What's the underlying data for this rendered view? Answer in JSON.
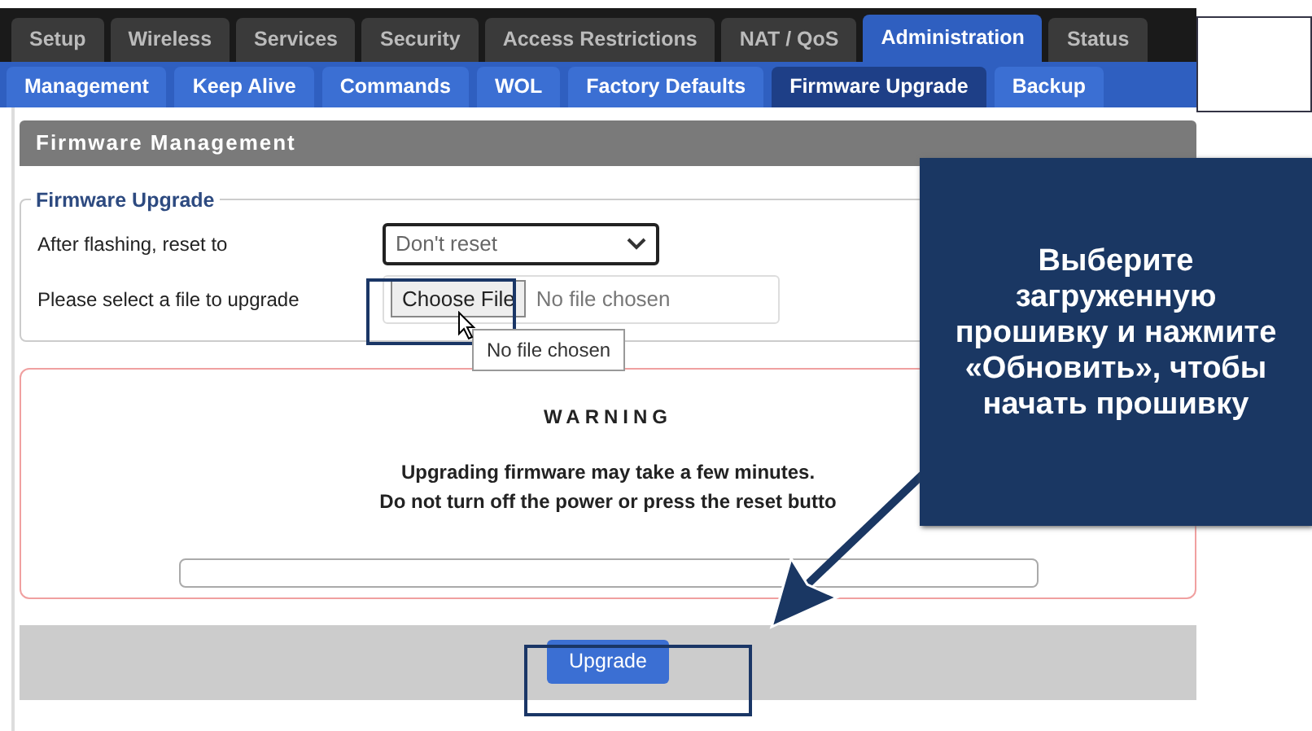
{
  "top_tabs": [
    {
      "label": "Setup",
      "selected": false
    },
    {
      "label": "Wireless",
      "selected": false
    },
    {
      "label": "Services",
      "selected": false
    },
    {
      "label": "Security",
      "selected": false
    },
    {
      "label": "Access Restrictions",
      "selected": false
    },
    {
      "label": "NAT / QoS",
      "selected": false
    },
    {
      "label": "Administration",
      "selected": true
    },
    {
      "label": "Status",
      "selected": false
    }
  ],
  "sub_tabs": [
    {
      "label": "Management",
      "selected": false
    },
    {
      "label": "Keep Alive",
      "selected": false
    },
    {
      "label": "Commands",
      "selected": false
    },
    {
      "label": "WOL",
      "selected": false
    },
    {
      "label": "Factory Defaults",
      "selected": false
    },
    {
      "label": "Firmware Upgrade",
      "selected": true
    },
    {
      "label": "Backup",
      "selected": false
    }
  ],
  "section_title": "Firmware Management",
  "fieldset": {
    "legend": "Firmware Upgrade",
    "rows": [
      {
        "kind": "select",
        "label": "After flashing, reset to",
        "value": "Don't reset"
      },
      {
        "kind": "file",
        "label": "Please select a file to upgrade",
        "button": "Choose File",
        "value": "No file chosen"
      }
    ]
  },
  "tooltip": "No file chosen",
  "warning": {
    "title": "WARNING",
    "lines": [
      "Upgrading firmware may take a few minutes.",
      "Do not turn off the power or press the reset butto"
    ]
  },
  "upgrade_button": "Upgrade",
  "callout": {
    "text": "Выберите загруженную прошивку и нажмите «Обновить», чтобы начать прошивку"
  }
}
